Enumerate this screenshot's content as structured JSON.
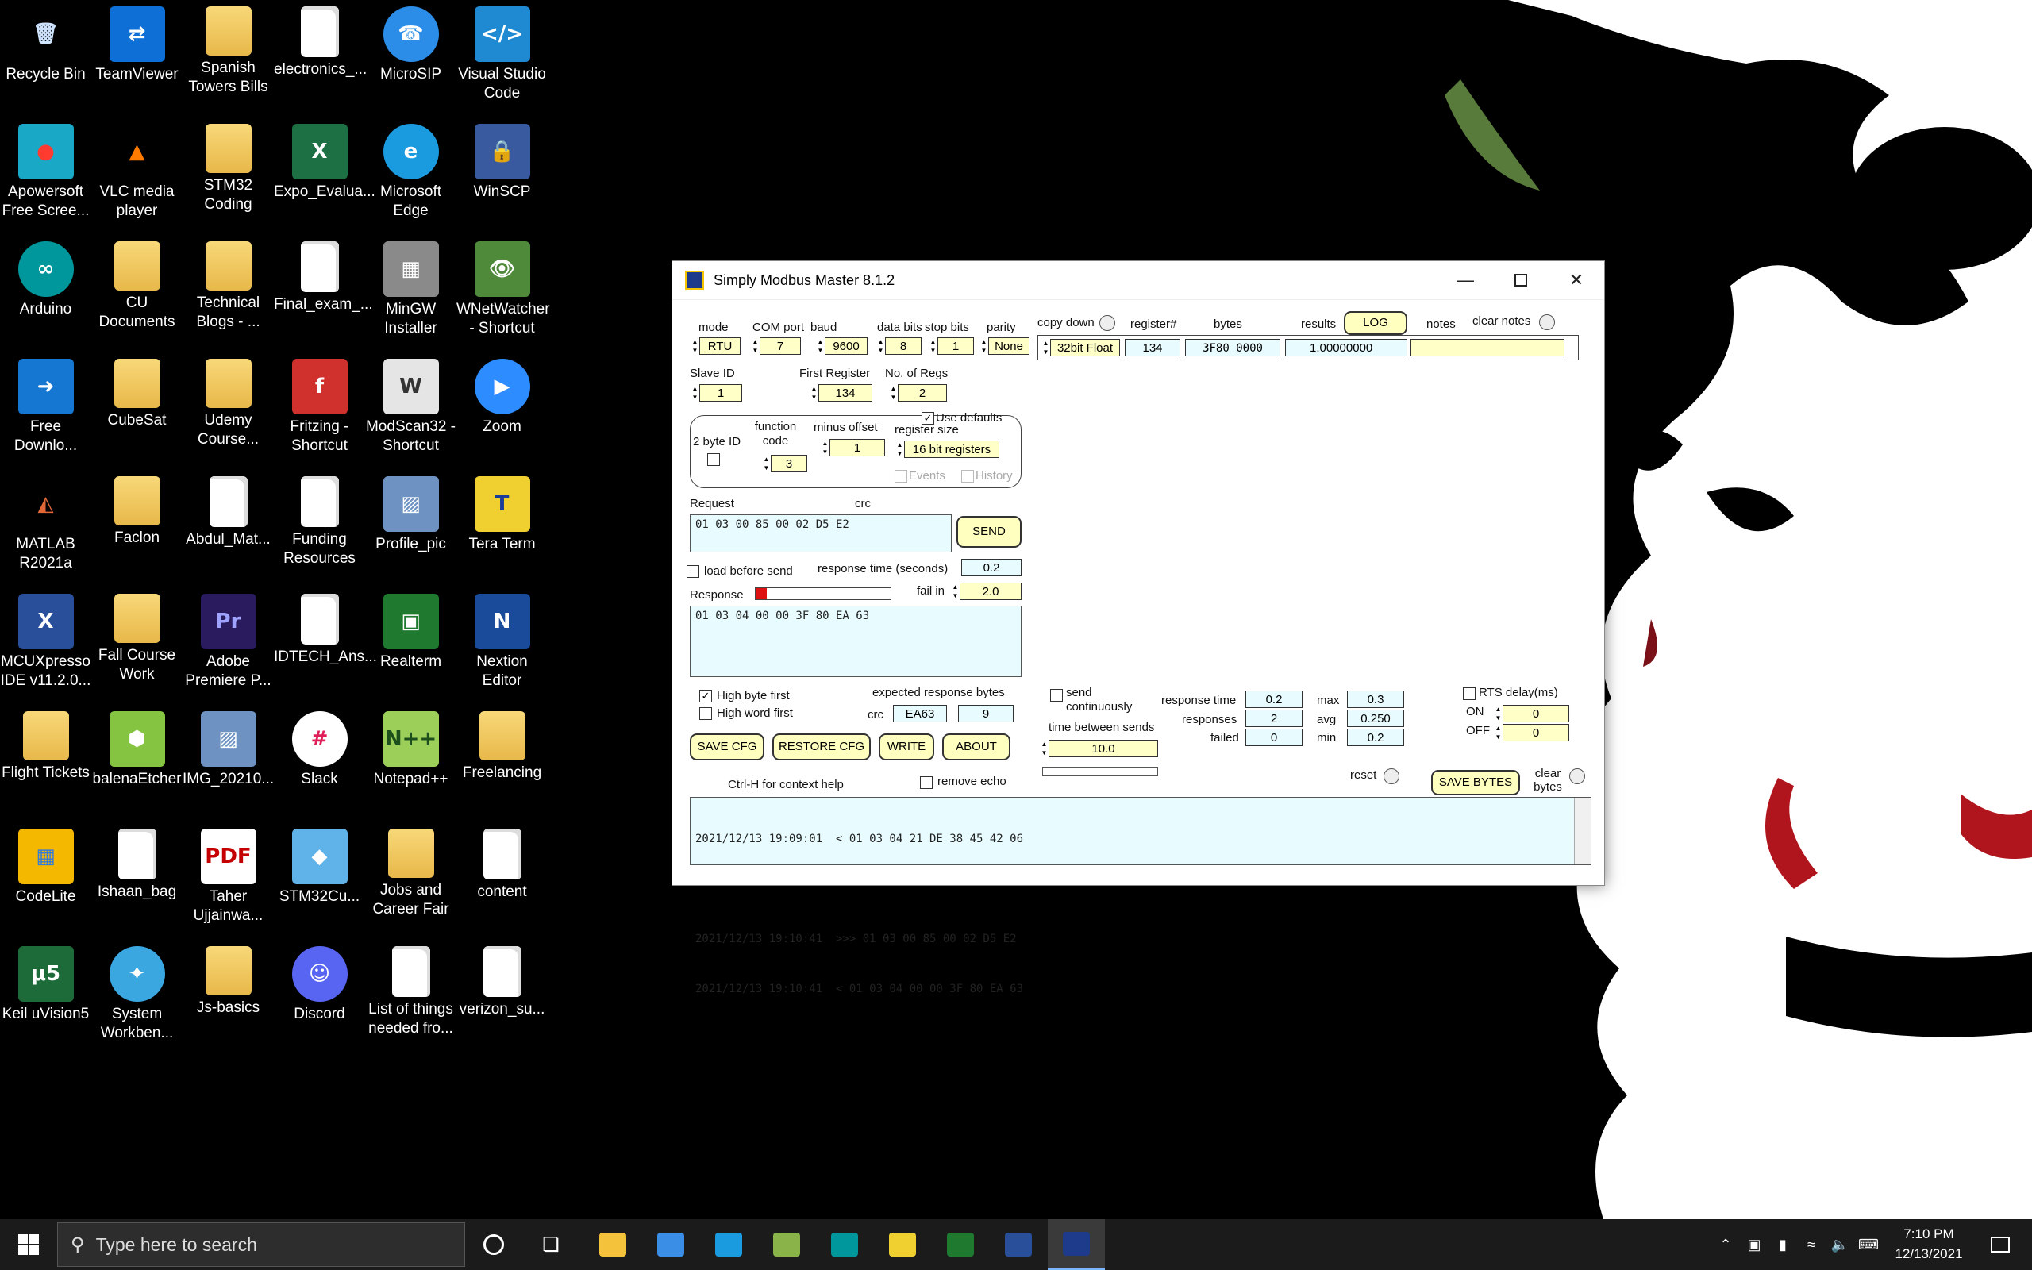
{
  "desktop": {
    "icons": [
      {
        "label": "Recycle Bin",
        "icon": "recycle-bin-icon"
      },
      {
        "label": "TeamViewer",
        "icon": "teamviewer-icon"
      },
      {
        "label": "Spanish Towers Bills",
        "icon": "folder-icon"
      },
      {
        "label": "electronics_...",
        "icon": "document-icon"
      },
      {
        "label": "MicroSIP",
        "icon": "microsip-icon"
      },
      {
        "label": "Visual Studio Code",
        "icon": "vscode-icon"
      },
      {
        "label": "Apowersoft Free Scree...",
        "icon": "apowersoft-icon"
      },
      {
        "label": "VLC media player",
        "icon": "vlc-icon"
      },
      {
        "label": "STM32 Coding",
        "icon": "folder-icon"
      },
      {
        "label": "Expo_Evalua...",
        "icon": "excel-icon"
      },
      {
        "label": "Microsoft Edge",
        "icon": "edge-icon"
      },
      {
        "label": "WinSCP",
        "icon": "winscp-icon"
      },
      {
        "label": "Arduino",
        "icon": "arduino-icon"
      },
      {
        "label": "CU Documents",
        "icon": "folder-icon"
      },
      {
        "label": "Technical Blogs - ...",
        "icon": "folder-icon"
      },
      {
        "label": "Final_exam_...",
        "icon": "document-icon"
      },
      {
        "label": "MinGW Installer",
        "icon": "mingw-icon"
      },
      {
        "label": "WNetWatcher - Shortcut",
        "icon": "wnetwatcher-icon"
      },
      {
        "label": "Free Downlo...",
        "icon": "free-download-icon"
      },
      {
        "label": "CubeSat",
        "icon": "folder-icon"
      },
      {
        "label": "Udemy Course...",
        "icon": "folder-icon"
      },
      {
        "label": "Fritzing - Shortcut",
        "icon": "fritzing-icon"
      },
      {
        "label": "ModScan32 - Shortcut",
        "icon": "modscan-icon"
      },
      {
        "label": "Zoom",
        "icon": "zoom-icon"
      },
      {
        "label": "MATLAB R2021a",
        "icon": "matlab-icon"
      },
      {
        "label": "Faclon",
        "icon": "folder-icon"
      },
      {
        "label": "Abdul_Mat...",
        "icon": "document-icon"
      },
      {
        "label": "Funding Resources",
        "icon": "document-icon"
      },
      {
        "label": "Profile_pic",
        "icon": "image-icon"
      },
      {
        "label": "Tera Term",
        "icon": "teraterm-icon"
      },
      {
        "label": "MCUXpresso IDE v11.2.0...",
        "icon": "mcuxpresso-icon"
      },
      {
        "label": "Fall Course Work",
        "icon": "folder-icon"
      },
      {
        "label": "Adobe Premiere P...",
        "icon": "premiere-icon"
      },
      {
        "label": "IDTECH_Ans...",
        "icon": "document-icon"
      },
      {
        "label": "Realterm",
        "icon": "realterm-icon"
      },
      {
        "label": "Nextion Editor",
        "icon": "nextion-icon"
      },
      {
        "label": "Flight Tickets",
        "icon": "folder-icon"
      },
      {
        "label": "balenaEtcher",
        "icon": "balena-icon"
      },
      {
        "label": "IMG_20210...",
        "icon": "image-icon"
      },
      {
        "label": "Slack",
        "icon": "slack-icon"
      },
      {
        "label": "Notepad++",
        "icon": "notepadpp-icon"
      },
      {
        "label": "Freelancing",
        "icon": "folder-icon"
      },
      {
        "label": "CodeLite",
        "icon": "codelite-icon"
      },
      {
        "label": "Ishaan_bag",
        "icon": "document-icon"
      },
      {
        "label": "Taher Ujjainwa...",
        "icon": "pdf-icon"
      },
      {
        "label": "STM32Cu...",
        "icon": "stm32cube-icon"
      },
      {
        "label": "Jobs and Career Fair",
        "icon": "folder-icon"
      },
      {
        "label": "content",
        "icon": "document-icon"
      },
      {
        "label": "Keil uVision5",
        "icon": "keil-icon"
      },
      {
        "label": "System Workben...",
        "icon": "system-workbench-icon"
      },
      {
        "label": "Js-basics",
        "icon": "folder-icon"
      },
      {
        "label": "Discord",
        "icon": "discord-icon"
      },
      {
        "label": "List of things needed fro...",
        "icon": "document-icon"
      },
      {
        "label": "verizon_su...",
        "icon": "document-icon"
      }
    ]
  },
  "window": {
    "title": "Simply Modbus Master 8.1.2",
    "labels": {
      "mode": "mode",
      "com_port": "COM port",
      "baud": "baud",
      "data_bits": "data bits",
      "stop_bits": "stop bits",
      "parity": "parity",
      "copy_down": "copy down",
      "register_num": "register#",
      "bytes": "bytes",
      "results": "results",
      "notes": "notes",
      "clear_notes": "clear notes",
      "slave_id": "Slave ID",
      "first_register": "First Register",
      "no_of_regs": "No. of Regs",
      "use_defaults": "Use defaults",
      "two_byte_id": "2 byte ID",
      "function_code": "function code",
      "minus_offset": "minus offset",
      "register_size": "register size",
      "events": "Events",
      "history": "History",
      "request": "Request",
      "crc": "crc",
      "load_before_send": "load before send",
      "response_time_seconds": "response time (seconds)",
      "response": "Response",
      "fail_in": "fail in",
      "high_byte_first": "High byte first",
      "high_word_first": "High word first",
      "expected_response_bytes": "expected response bytes",
      "crc2": "crc",
      "send_continuously": "send continuously",
      "time_between_sends": "time between sends",
      "response_time": "response time",
      "responses": "responses",
      "failed": "failed",
      "max": "max",
      "avg": "avg",
      "min": "min",
      "rts_delay": "RTS delay(ms)",
      "on": "ON",
      "off": "OFF",
      "reset": "reset",
      "clear_bytes": "clear bytes",
      "ctrl_h": "Ctrl-H for context help",
      "remove_echo": "remove echo"
    },
    "values": {
      "mode": "RTU",
      "com_port": "7",
      "baud": "9600",
      "data_bits": "8",
      "stop_bits": "1",
      "parity": "None",
      "data_type": "32bit Float",
      "register_num": "134",
      "bytes": "3F80 0000",
      "results": "1.00000000",
      "notes": "",
      "slave_id": "1",
      "first_register": "134",
      "no_of_regs": "2",
      "function_code": "3",
      "minus_offset": "1",
      "register_size": "16 bit registers",
      "request": "01 03 00 85 00 02 D5 E2",
      "response_time_seconds": "0.2",
      "fail_in": "2.0",
      "response": "01 03 04 00 00 3F 80 EA 63",
      "crc": "EA63",
      "expected_bytes": "9",
      "time_between_sends": "10.0",
      "stat_response_time": "0.2",
      "stat_responses": "2",
      "stat_failed": "0",
      "stat_max": "0.3",
      "stat_avg": "0.250",
      "stat_min": "0.2",
      "rts_on": "0",
      "rts_off": "0"
    },
    "checks": {
      "use_defaults": true,
      "two_byte_id": false,
      "events": false,
      "history": false,
      "load_before_send": false,
      "high_byte_first": true,
      "high_word_first": false,
      "send_continuously": false,
      "rts_delay": false,
      "remove_echo": false
    },
    "buttons": {
      "log": "LOG",
      "send": "SEND",
      "save_cfg": "SAVE CFG",
      "restore_cfg": "RESTORE CFG",
      "write": "WRITE",
      "about": "ABOUT",
      "save_bytes": "SAVE BYTES"
    },
    "log_lines": [
      "2021/12/13 19:09:01  < 01 03 04 21 DE 38 45 42 06",
      "",
      "2021/12/13 19:10:41  >>> 01 03 00 85 00 02 D5 E2",
      "2021/12/13 19:10:41  < 01 03 04 00 00 3F 80 EA 63"
    ],
    "response_progress_percent": 8
  },
  "taskbar": {
    "search_placeholder": "Type here to search",
    "apps": [
      "file-explorer-icon",
      "store-icon",
      "edge-icon",
      "expo-app-icon",
      "arduino-icon",
      "teraterm-icon",
      "realterm-icon",
      "mcuxpresso-icon",
      "simply-modbus-icon"
    ],
    "time": "7:10 PM",
    "date": "12/13/2021"
  },
  "colors": {
    "field_bg": "#ffffc8",
    "log_bg": "#e8fbff",
    "taskbar": "#1b1b1b",
    "progress_fill": "#dd1111"
  }
}
